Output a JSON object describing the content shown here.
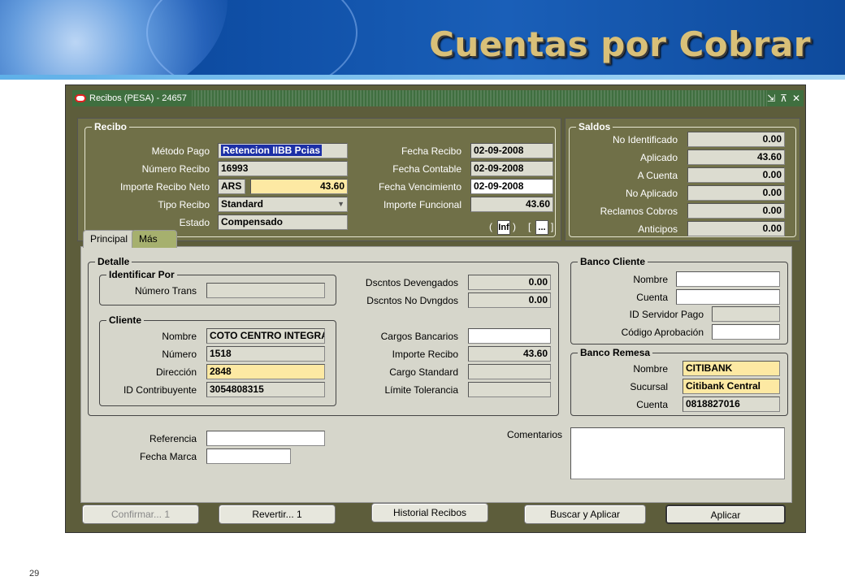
{
  "slide": {
    "title": "Cuentas por Cobrar",
    "page_number": "29"
  },
  "window": {
    "title": "Recibos (PESA) - 24657",
    "controls": [
      "⇲",
      "⊼",
      "✕"
    ]
  },
  "recibo": {
    "legend": "Recibo",
    "metodo_pago": {
      "label": "Método Pago",
      "value": "Retencion IIBB Pcias"
    },
    "numero_recibo": {
      "label": "Número Recibo",
      "value": "16993"
    },
    "importe_neto": {
      "label": "Importe Recibo Neto",
      "currency": "ARS",
      "value": "43.60"
    },
    "tipo_recibo": {
      "label": "Tipo Recibo",
      "value": "Standard"
    },
    "estado": {
      "label": "Estado",
      "value": "Compensado"
    },
    "fecha_recibo": {
      "label": "Fecha Recibo",
      "value": "02-09-2008"
    },
    "fecha_contable": {
      "label": "Fecha Contable",
      "value": "02-09-2008"
    },
    "fecha_vencimiento": {
      "label": "Fecha Vencimiento",
      "value": "02-09-2008"
    },
    "importe_funcional": {
      "label": "Importe Funcional",
      "value": "43.60"
    },
    "info_box": "Inf",
    "ellipsis_box": "...",
    "paren_open": "(",
    "paren_close": ")",
    "bracket_open": "[",
    "bracket_close": "]"
  },
  "saldos": {
    "legend": "Saldos",
    "rows": [
      {
        "label": "No Identificado",
        "value": "0.00"
      },
      {
        "label": "Aplicado",
        "value": "43.60"
      },
      {
        "label": "A Cuenta",
        "value": "0.00"
      },
      {
        "label": "No Aplicado",
        "value": "0.00"
      },
      {
        "label": "Reclamos Cobros",
        "value": "0.00"
      },
      {
        "label": "Anticipos",
        "value": "0.00"
      }
    ]
  },
  "tabs": [
    {
      "label": "Principal",
      "active": true
    },
    {
      "label": "Más",
      "active": false
    }
  ],
  "detalle": {
    "legend": "Detalle",
    "identificar_por": {
      "legend": "Identificar Por",
      "numero_trans_label": "Número Trans",
      "numero_trans_value": ""
    },
    "cliente": {
      "legend": "Cliente",
      "nombre": {
        "label": "Nombre",
        "value": "COTO CENTRO INTEGRAI"
      },
      "numero": {
        "label": "Número",
        "value": "1518"
      },
      "direccion": {
        "label": "Dirección",
        "value": "2848"
      },
      "id_contribuyente": {
        "label": "ID Contribuyente",
        "value": "3054808315"
      }
    },
    "dsctos_devengados": {
      "label": "Dscntos Devengados",
      "value": "0.00"
    },
    "dsctos_no_devengados": {
      "label": "Dscntos No Dvngdos",
      "value": "0.00"
    },
    "cargos_bancarios": {
      "label": "Cargos Bancarios",
      "value": ""
    },
    "importe_recibo": {
      "label": "Importe Recibo",
      "value": "43.60"
    },
    "cargo_standard": {
      "label": "Cargo Standard",
      "value": ""
    },
    "limite_tolerancia": {
      "label": "Límite Tolerancia",
      "value": ""
    }
  },
  "banco_cliente": {
    "legend": "Banco Cliente",
    "nombre": {
      "label": "Nombre",
      "value": ""
    },
    "cuenta": {
      "label": "Cuenta",
      "value": ""
    },
    "id_servidor_pago": {
      "label": "ID Servidor Pago",
      "value": ""
    },
    "codigo_aprobacion": {
      "label": "Código Aprobación",
      "value": ""
    }
  },
  "banco_remesa": {
    "legend": "Banco Remesa",
    "nombre": {
      "label": "Nombre",
      "value": "CITIBANK"
    },
    "sucursal": {
      "label": "Sucursal",
      "value": "Citibank Central"
    },
    "cuenta": {
      "label": "Cuenta",
      "value": "0818827016"
    }
  },
  "otros": {
    "referencia": {
      "label": "Referencia",
      "value": ""
    },
    "fecha_marca": {
      "label": "Fecha Marca",
      "value": ""
    },
    "comentarios": {
      "label": "Comentarios",
      "value": ""
    }
  },
  "buttons": {
    "confirmar": "Confirmar... 1",
    "revertir": "Revertir... 1",
    "historial": "Historial Recibos",
    "buscar_aplicar": "Buscar y Aplicar",
    "aplicar": "Aplicar"
  }
}
